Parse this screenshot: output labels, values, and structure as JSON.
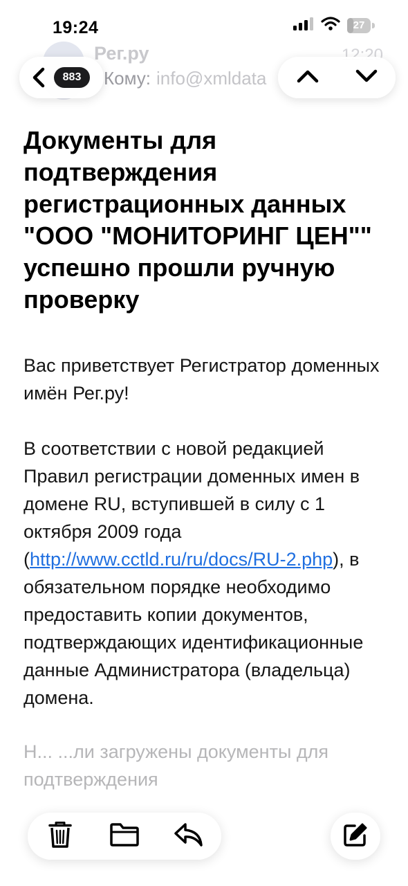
{
  "status_bar": {
    "time": "19:24",
    "battery_level": "27",
    "battery_fraction": 0.27
  },
  "header": {
    "sender_name": "Рег.ру",
    "time": "12:20",
    "recipient_label": "Кому:",
    "recipient_email": "info@xmldata",
    "message_count": "883"
  },
  "email": {
    "subject": "Документы для подтверждения регистрационных данных \"ООО \"МОНИТОРИНГ ЦЕН\"\" успешно прошли ручную проверку",
    "greeting": "Вас приветствует Регистратор доменных имён Рег.ру!",
    "body_part1": "В соответствии с новой редакцией Правил регистрации доменных имен в домене RU, вступившей в силу с 1 октября 2009 года (",
    "link": "http://www.cctld.ru/ru/docs/RU-2.php",
    "body_part2": "), в обязательном порядке необходимо предоставить копии документов, подтверждающих идентификационные данные Администратора (владельца) домена.",
    "faded_text": "Н... ...ли загружены документы для подтверждения"
  },
  "icons": {
    "back": "chevron-left-icon",
    "prev": "chevron-up-icon",
    "next": "chevron-down-icon",
    "trash": "trash-icon",
    "folder": "folder-icon",
    "reply": "reply-icon",
    "compose": "compose-icon",
    "signal": "signal-icon",
    "wifi": "wifi-icon",
    "battery": "battery-icon"
  },
  "colors": {
    "link": "#1f6fe0",
    "badge_bg": "#1c1c1e",
    "text": "#111111"
  }
}
